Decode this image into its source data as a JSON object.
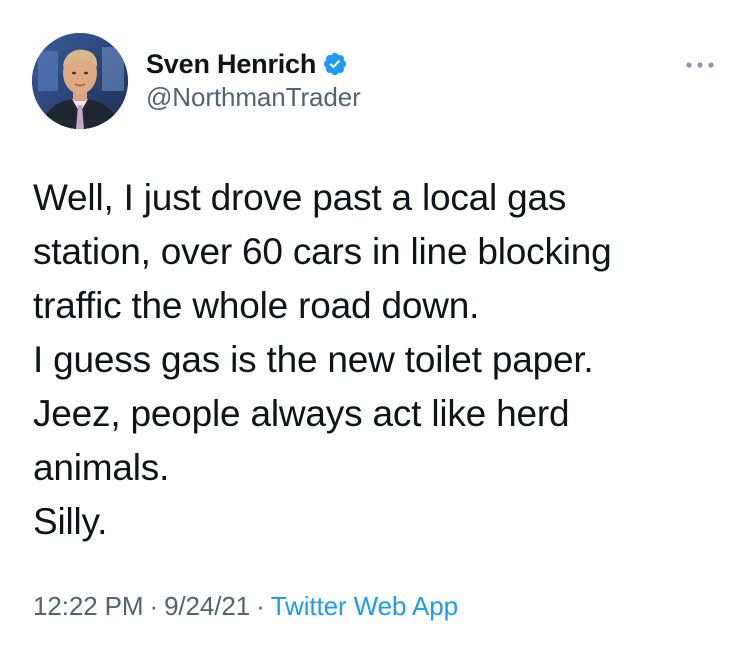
{
  "author": {
    "display_name": "Sven Henrich",
    "handle": "@NorthmanTrader",
    "verified": true
  },
  "tweet": {
    "lines": [
      "Well, I just drove past a local gas",
      "station, over 60 cars in line blocking",
      "traffic the whole road down.",
      "I guess gas is the new toilet paper.",
      "Jeez, people always act like herd",
      "animals.",
      "Silly."
    ]
  },
  "meta": {
    "time": "12:22 PM",
    "separator": "·",
    "date": "9/24/21",
    "source": "Twitter Web App"
  },
  "icons": {
    "verified": "verified-badge-icon",
    "more": "more-options-icon"
  },
  "colors": {
    "accent": "#1d9bf0",
    "secondary_text": "#536471",
    "primary_text": "#0f1419"
  }
}
